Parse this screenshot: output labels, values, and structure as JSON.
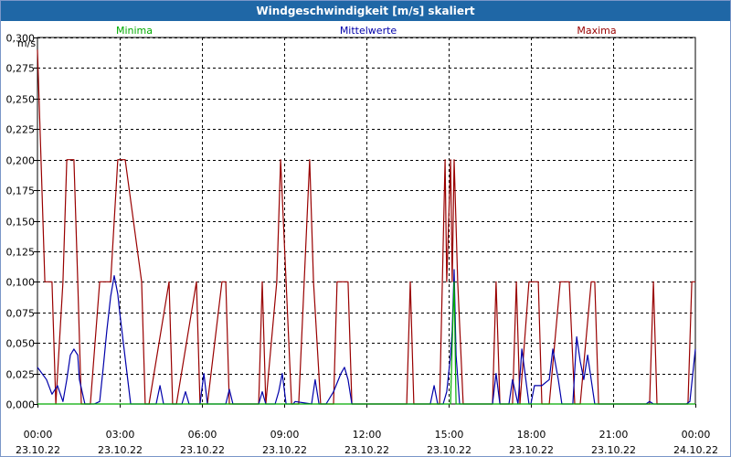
{
  "window": {
    "title": "Windgeschwindigkeit [m/s] skaliert"
  },
  "chart_data": {
    "type": "line",
    "ylabel": "m/s",
    "ylim": [
      0,
      0.3
    ],
    "yticks": [
      0,
      0.025,
      0.05,
      0.075,
      0.1,
      0.125,
      0.15,
      0.175,
      0.2,
      0.225,
      0.25,
      0.275,
      0.3
    ],
    "ytick_labels": [
      "0,000",
      "0,025",
      "0,050",
      "0,075",
      "0,100",
      "0,125",
      "0,150",
      "0,175",
      "0,200",
      "0,225",
      "0,250",
      "0,275",
      "0,300"
    ],
    "xlim": [
      0,
      24
    ],
    "xticks": [
      0,
      3,
      6,
      9,
      12,
      15,
      18,
      21,
      24
    ],
    "xtick_labels": [
      {
        "time": "00:00",
        "date": "23.10.22"
      },
      {
        "time": "03:00",
        "date": "23.10.22"
      },
      {
        "time": "06:00",
        "date": "23.10.22"
      },
      {
        "time": "09:00",
        "date": "23.10.22"
      },
      {
        "time": "12:00",
        "date": "23.10.22"
      },
      {
        "time": "15:00",
        "date": "23.10.22"
      },
      {
        "time": "18:00",
        "date": "23.10.22"
      },
      {
        "time": "21:00",
        "date": "23.10.22"
      },
      {
        "time": "00:00",
        "date": "24.10.22"
      }
    ],
    "grid": true,
    "colors": {
      "min": "#00aa00",
      "mean": "#0000aa",
      "max": "#990000",
      "grid": "#000000"
    },
    "series": [
      {
        "name": "Minima",
        "color": "#00aa00",
        "x": [
          0,
          15.07,
          15.13,
          15.2,
          15.27,
          24
        ],
        "y": [
          0,
          0,
          0.05,
          0.1,
          0,
          0
        ]
      },
      {
        "name": "Mittelwerte",
        "color": "#0000aa",
        "x": [
          0,
          0.33,
          0.53,
          0.73,
          0.93,
          1.07,
          1.2,
          1.33,
          1.47,
          1.53,
          1.73,
          1.93,
          2.07,
          2.27,
          2.4,
          2.53,
          2.67,
          2.8,
          2.93,
          3,
          3.4,
          3.67,
          3.8,
          4.33,
          4.47,
          4.6,
          5.27,
          5.4,
          5.53,
          5.93,
          6.07,
          6.2,
          6.33,
          6.87,
          7,
          7.13,
          7.27,
          8.07,
          8.2,
          8.33,
          8.67,
          8.8,
          8.93,
          9.07,
          9.33,
          9.4,
          10,
          10.13,
          10.27,
          10.53,
          10.8,
          11.07,
          11.2,
          11.33,
          11.47,
          14.33,
          14.47,
          14.6,
          14.8,
          14.93,
          15.07,
          15.13,
          15.2,
          15.27,
          15.4,
          15.53,
          15.67,
          16.6,
          16.73,
          16.87,
          17.2,
          17.33,
          17.53,
          17.67,
          17.93,
          18,
          18.13,
          18.4,
          18.67,
          18.8,
          19,
          19.13,
          19.4,
          19.53,
          19.67,
          19.8,
          19.93,
          20.07,
          20.2,
          20.33,
          22.2,
          22.33,
          22.47,
          22.67,
          23.47,
          23.67,
          23.8,
          24
        ],
        "y": [
          0.03,
          0.02,
          0.008,
          0.015,
          0.002,
          0.02,
          0.04,
          0.045,
          0.04,
          0.02,
          0,
          0,
          0,
          0.002,
          0.03,
          0.06,
          0.088,
          0.105,
          0.09,
          0.075,
          0,
          0,
          0,
          0,
          0.015,
          0,
          0,
          0.01,
          0,
          0,
          0.025,
          0,
          0,
          0,
          0.012,
          0,
          0,
          0,
          0.01,
          0,
          0,
          0.01,
          0.025,
          0,
          0,
          0.002,
          0,
          0.02,
          0,
          0,
          0.01,
          0.025,
          0.03,
          0.02,
          0,
          0,
          0.015,
          0,
          0,
          0.01,
          0.04,
          0.06,
          0.11,
          0.04,
          0,
          0,
          0,
          0,
          0.025,
          0,
          0,
          0.02,
          0,
          0.045,
          0,
          0,
          0.015,
          0.015,
          0.02,
          0.045,
          0.02,
          0,
          0,
          0,
          0.055,
          0.035,
          0.02,
          0.04,
          0.02,
          0,
          0,
          0.002,
          0,
          0,
          0,
          0,
          0.002,
          0.045
        ]
      },
      {
        "name": "Maxima",
        "color": "#990000",
        "x": [
          0,
          0.13,
          0.27,
          0.53,
          0.67,
          0.93,
          1.07,
          1.33,
          1.47,
          1.6,
          1.93,
          2.27,
          2.67,
          2.93,
          3.2,
          3.8,
          3.93,
          4.07,
          4.8,
          4.93,
          5.07,
          5.8,
          5.93,
          6.2,
          6.73,
          6.87,
          7,
          8.07,
          8.2,
          8.33,
          8.73,
          8.87,
          9.07,
          9.27,
          9.4,
          9.53,
          9.73,
          9.93,
          10.07,
          10.33,
          10.8,
          10.93,
          11.2,
          11.33,
          11.47,
          13.47,
          13.6,
          13.73,
          14.67,
          14.87,
          14.93,
          15.07,
          15.13,
          15.2,
          15.33,
          15.53,
          15.67,
          16.6,
          16.73,
          16.87,
          17.33,
          17.47,
          17.6,
          17.93,
          18,
          18.13,
          18.27,
          18.4,
          18.67,
          19.07,
          19.4,
          19.6,
          19.8,
          20.2,
          20.33,
          20.47,
          22.33,
          22.47,
          22.6,
          23.73,
          23.87,
          24
        ],
        "y": [
          0.29,
          0.2,
          0.1,
          0.1,
          0,
          0.1,
          0.2,
          0.2,
          0.1,
          0,
          0,
          0.1,
          0.1,
          0.2,
          0.2,
          0.1,
          0,
          0,
          0.1,
          0,
          0,
          0.1,
          0,
          0,
          0.1,
          0.1,
          0,
          0,
          0.1,
          0,
          0.1,
          0.2,
          0.1,
          0,
          0,
          0,
          0.1,
          0.2,
          0.1,
          0,
          0,
          0.1,
          0.1,
          0.1,
          0,
          0,
          0.1,
          0,
          0,
          0.2,
          0.1,
          0.2,
          0.1,
          0.2,
          0.1,
          0,
          0,
          0,
          0.1,
          0,
          0,
          0.1,
          0,
          0.1,
          0.1,
          0.1,
          0.1,
          0,
          0,
          0.1,
          0.1,
          0,
          0,
          0.1,
          0.1,
          0,
          0,
          0.1,
          0,
          0,
          0.1,
          0.1
        ]
      }
    ]
  }
}
